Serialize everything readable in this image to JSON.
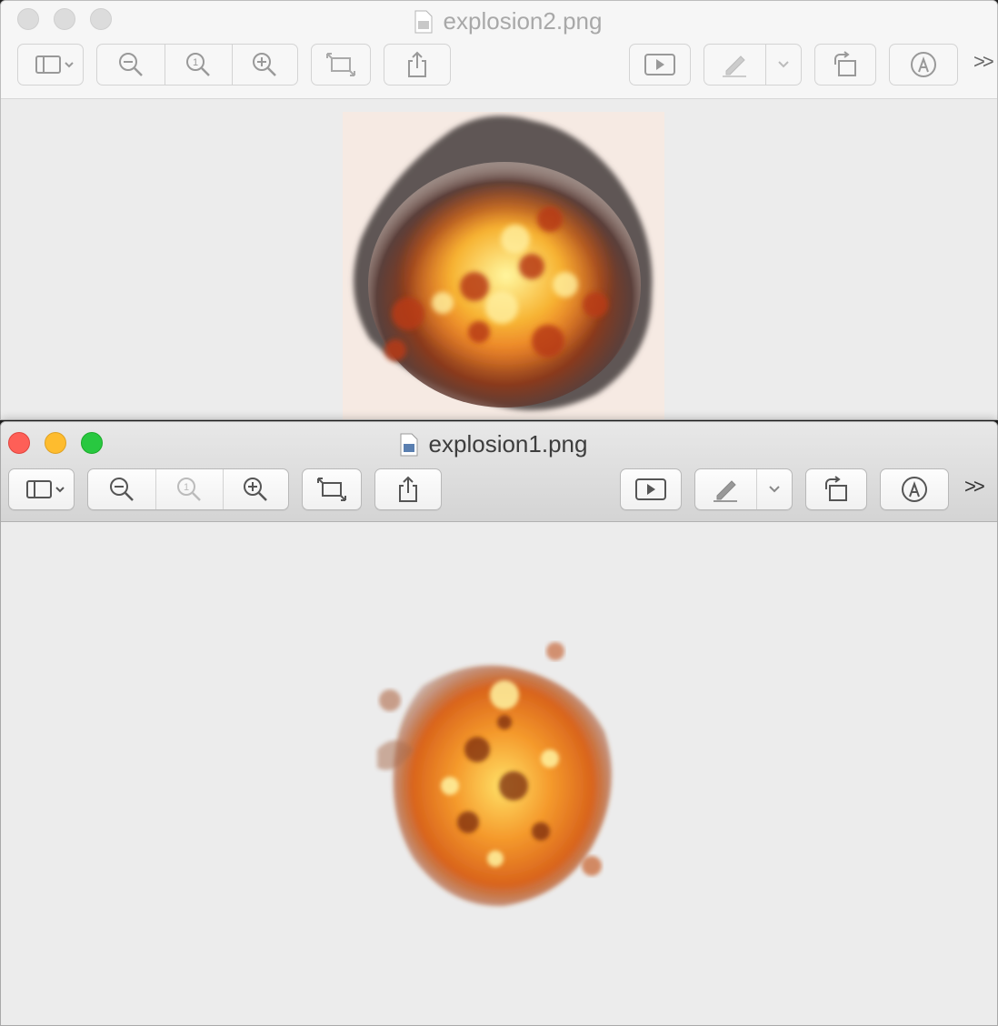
{
  "windows": [
    {
      "id": "back",
      "title": "explosion2.png",
      "active": false
    },
    {
      "id": "front",
      "title": "explosion1.png",
      "active": true
    }
  ],
  "toolbar": {
    "items": [
      "sidebar-toggle",
      "zoom-out",
      "actual-size",
      "zoom-in",
      "fit-to-window",
      "share",
      "slideshow",
      "markup-pen",
      "markup-menu",
      "rotate-left",
      "annotate",
      "more"
    ],
    "more_label": ">>"
  },
  "colors": {
    "close": "#fe5f57",
    "minimize": "#febc2e",
    "maximize": "#28c840",
    "inactive_light": "#dcdcdc"
  }
}
